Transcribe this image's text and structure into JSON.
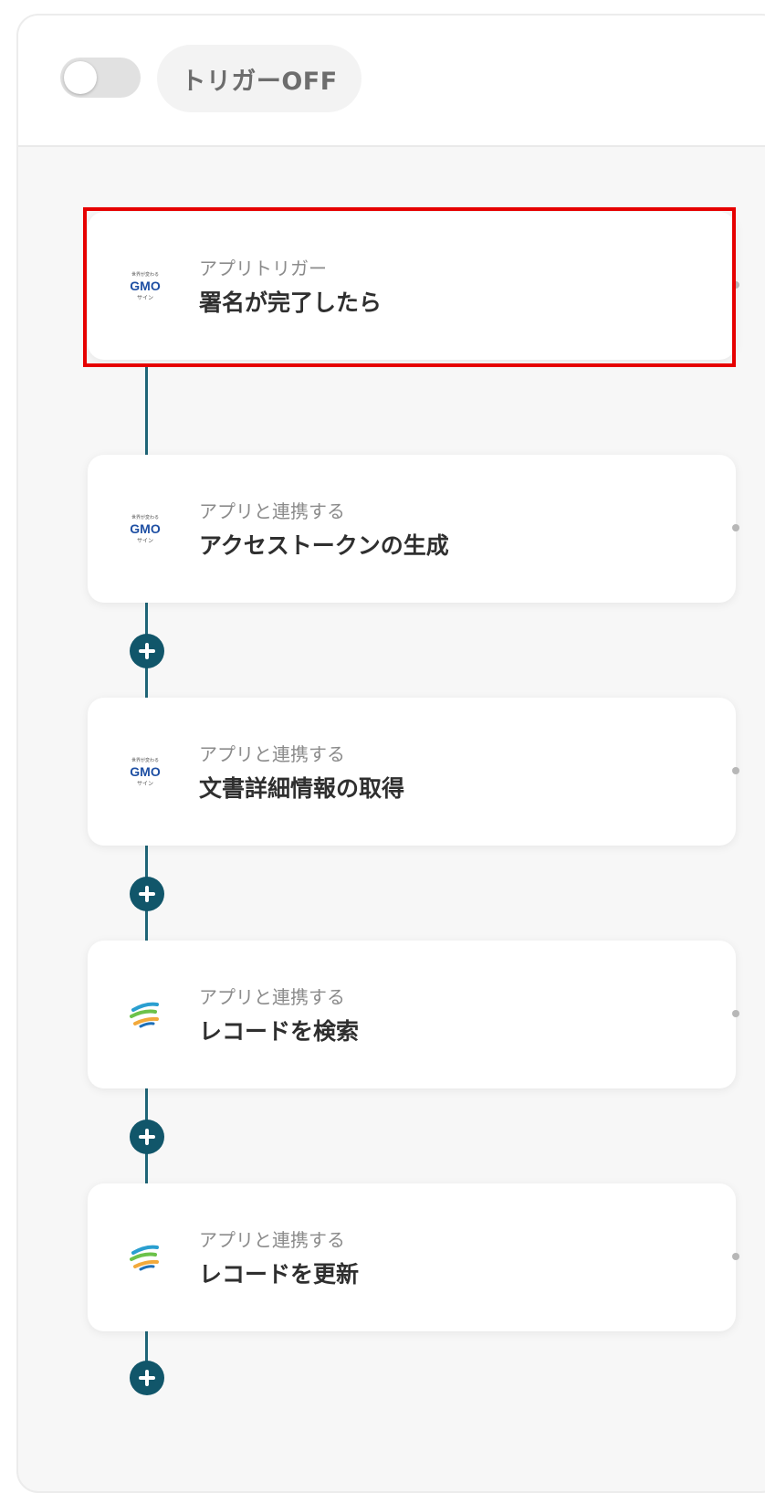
{
  "header": {
    "trigger_toggle_label": "トリガーOFF"
  },
  "gmo_logo": {
    "top_text": "世界が変わる",
    "brand_text": "GMO",
    "bottom_text": "サイン"
  },
  "flow": {
    "steps": [
      {
        "subtitle": "アプリトリガー",
        "title": "署名が完了したら",
        "icon": "gmo-sign-logo-icon"
      },
      {
        "subtitle": "アプリと連携する",
        "title": "アクセストークンの生成",
        "icon": "gmo-sign-logo-icon"
      },
      {
        "subtitle": "アプリと連携する",
        "title": "文書詳細情報の取得",
        "icon": "gmo-sign-logo-icon"
      },
      {
        "subtitle": "アプリと連携する",
        "title": "レコードを検索",
        "icon": "kintone-logo-icon"
      },
      {
        "subtitle": "アプリと連携する",
        "title": "レコードを更新",
        "icon": "kintone-logo-icon"
      }
    ]
  },
  "colors": {
    "connector": "#1f6577",
    "add_button": "#11566a",
    "highlight": "#e60000",
    "gmo_blue": "#1e4fa3"
  }
}
